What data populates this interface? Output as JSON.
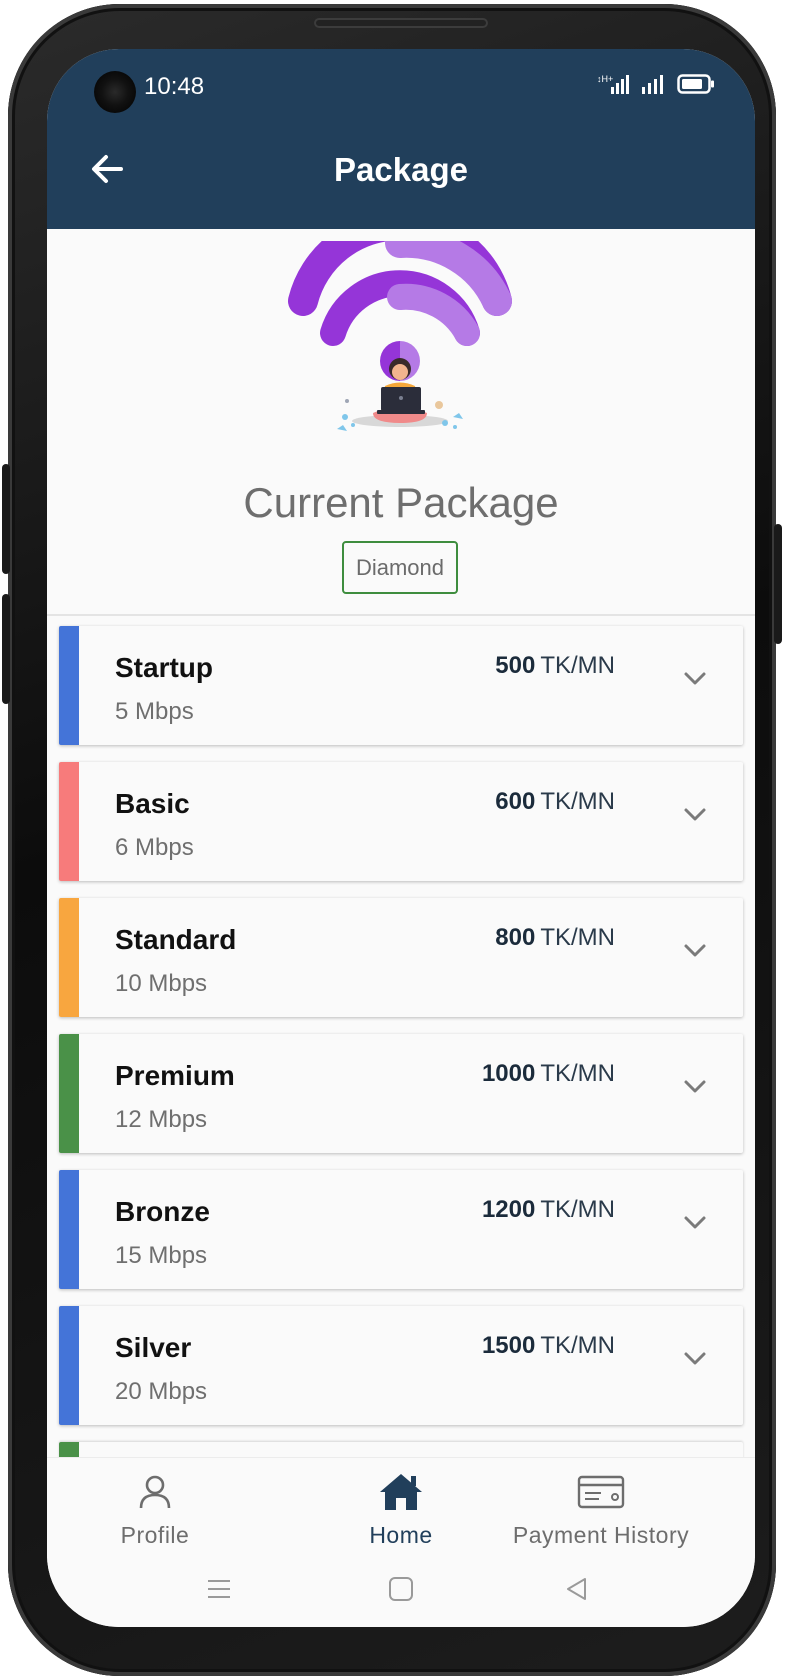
{
  "status_bar": {
    "time": "10:48",
    "icons": [
      "network-type-icon",
      "signal-icon",
      "signal-icon",
      "battery-icon"
    ]
  },
  "app_bar": {
    "title": "Package",
    "back_icon": "arrow-left-icon"
  },
  "hero": {
    "illustration": "wifi-person-laptop-illustration",
    "current_label": "Current Package",
    "current_package": "Diamond"
  },
  "packages": [
    {
      "name": "Startup",
      "speed": "5 Mbps",
      "price": "500",
      "unit": "TK/MN",
      "color": "#4474d8"
    },
    {
      "name": "Basic",
      "speed": "6 Mbps",
      "price": "600",
      "unit": "TK/MN",
      "color": "#f77b7b"
    },
    {
      "name": "Standard",
      "speed": "10 Mbps",
      "price": "800",
      "unit": "TK/MN",
      "color": "#f8a63f"
    },
    {
      "name": "Premium",
      "speed": "12 Mbps",
      "price": "1000",
      "unit": "TK/MN",
      "color": "#4a9148"
    },
    {
      "name": "Bronze",
      "speed": "15 Mbps",
      "price": "1200",
      "unit": "TK/MN",
      "color": "#4474d8"
    },
    {
      "name": "Silver",
      "speed": "20 Mbps",
      "price": "1500",
      "unit": "TK/MN",
      "color": "#4474d8"
    }
  ],
  "peek_card_color": "#4a9148",
  "bottom_nav": [
    {
      "label": "Profile",
      "icon": "person-icon",
      "active": false
    },
    {
      "label": "Home",
      "icon": "home-icon",
      "active": true
    },
    {
      "label": "Payment History",
      "icon": "credit-card-icon",
      "active": false
    }
  ],
  "colors": {
    "primary": "#213f5b",
    "badge_border": "#3e8d3e",
    "wifi_purple": "#9333d6"
  }
}
